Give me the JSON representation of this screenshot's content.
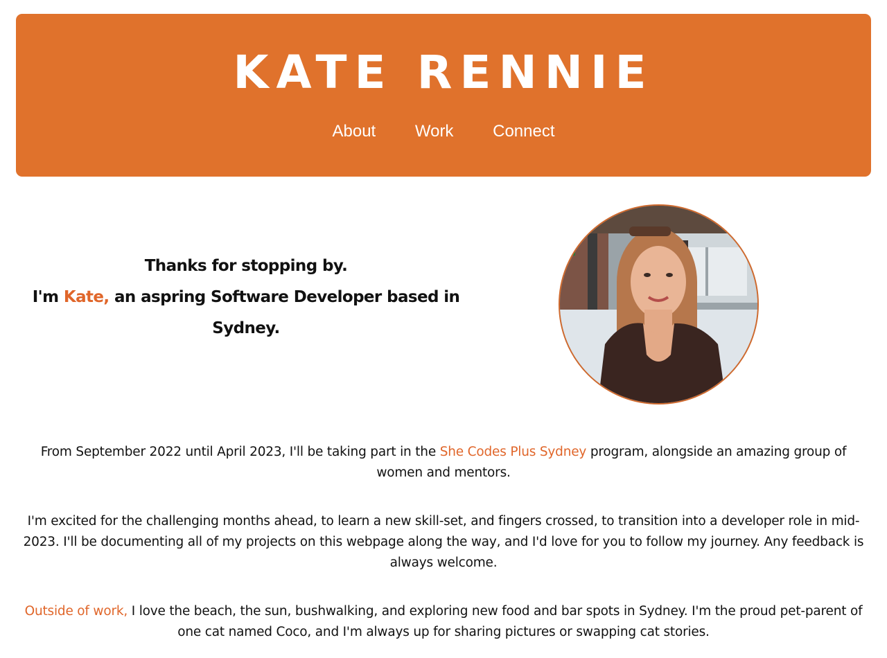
{
  "header": {
    "title": "KATE RENNIE",
    "nav": [
      {
        "label": "About"
      },
      {
        "label": "Work"
      },
      {
        "label": "Connect"
      }
    ]
  },
  "hero": {
    "line1": "Thanks for stopping by.",
    "line2_prefix": "I'm ",
    "name": "Kate,",
    "line2_suffix": " an aspring Software Developer based in Sydney.",
    "photo_alt": "Kate Rennie"
  },
  "intro": {
    "p1_before": "From September 2022 until April 2023, I'll be taking part in the ",
    "p1_link": "She Codes Plus Sydney",
    "p1_after": " program, alongside an amazing group of women and mentors.",
    "p2": "I'm excited for the challenging months ahead, to learn a new skill-set, and fingers crossed, to transition into a developer role in mid-2023. I'll be documenting all of my projects on this webpage along the way, and I'd love for you to follow my journey. Any feedback is always welcome.",
    "p3_highlight": "Outside of work,",
    "p3_after": " I love the beach, the sun, bushwalking, and exploring new food and bar spots in Sydney. I'm the proud pet-parent of one cat named Coco, and I'm always up for sharing pictures or swapping cat stories."
  },
  "colors": {
    "accent": "#e0722c",
    "accent_text": "#e0662a",
    "text": "#111111",
    "background": "#ffffff"
  }
}
